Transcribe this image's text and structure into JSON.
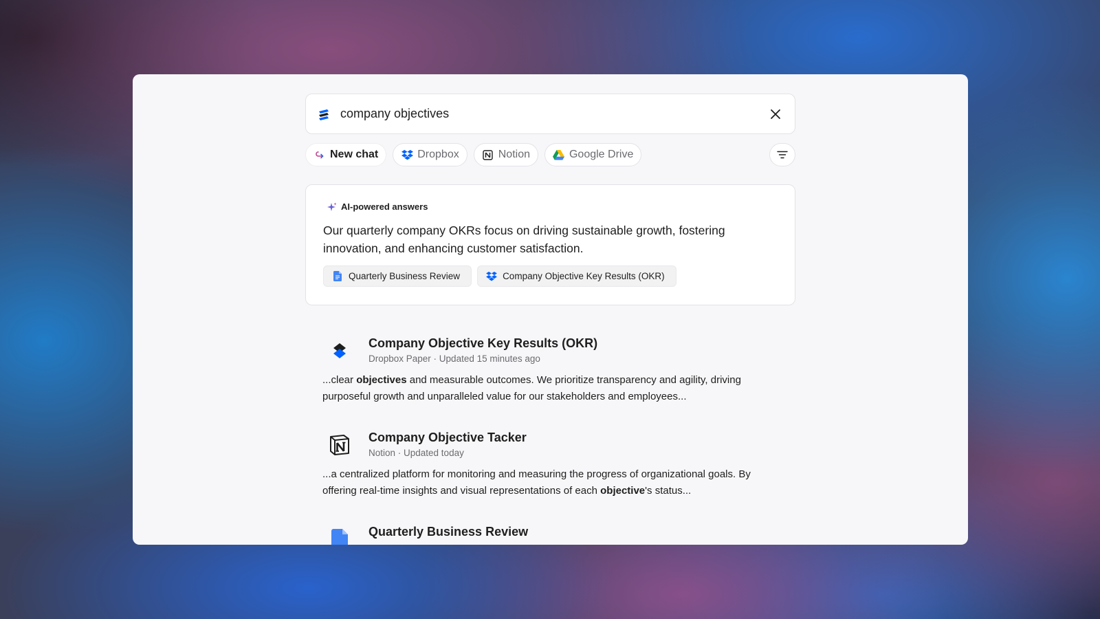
{
  "search": {
    "query": "company objectives"
  },
  "chips": [
    {
      "label": "New chat",
      "icon": "new-chat-icon"
    },
    {
      "label": "Dropbox",
      "icon": "dropbox-icon"
    },
    {
      "label": "Notion",
      "icon": "notion-icon"
    },
    {
      "label": "Google Drive",
      "icon": "google-drive-icon"
    }
  ],
  "ai": {
    "heading": "AI-powered answers",
    "answer": "Our quarterly company OKRs focus on driving sustainable growth, fostering innovation, and enhancing customer satisfaction.",
    "sources": [
      {
        "label": "Quarterly Business Review",
        "icon": "google-docs-icon"
      },
      {
        "label": "Company Objective Key Results (OKR)",
        "icon": "dropbox-icon"
      }
    ]
  },
  "results": [
    {
      "title": "Company Objective Key Results (OKR)",
      "meta": "Dropbox Paper · Updated 15 minutes ago",
      "snippet_pre": "...clear ",
      "snippet_bold": "objectives",
      "snippet_post": " and measurable outcomes. We prioritize transparency and agility, driving purposeful growth and unparalleled value for our stakeholders and employees...",
      "icon": "dropbox-paper-icon"
    },
    {
      "title": "Company Objective Tacker",
      "meta": "Notion · Updated today",
      "snippet_pre": "...a centralized platform for monitoring and measuring the progress of organizational goals. By offering real-time insights and visual representations of each ",
      "snippet_bold": "objective",
      "snippet_post": "'s status...",
      "icon": "notion-icon"
    },
    {
      "title": "Quarterly Business Review",
      "icon": "google-docs-icon"
    }
  ],
  "colors": {
    "accent_blue": "#0061fe",
    "window_bg": "#f7f7f9",
    "text": "#1e1e1e",
    "muted": "#6b6b70"
  }
}
